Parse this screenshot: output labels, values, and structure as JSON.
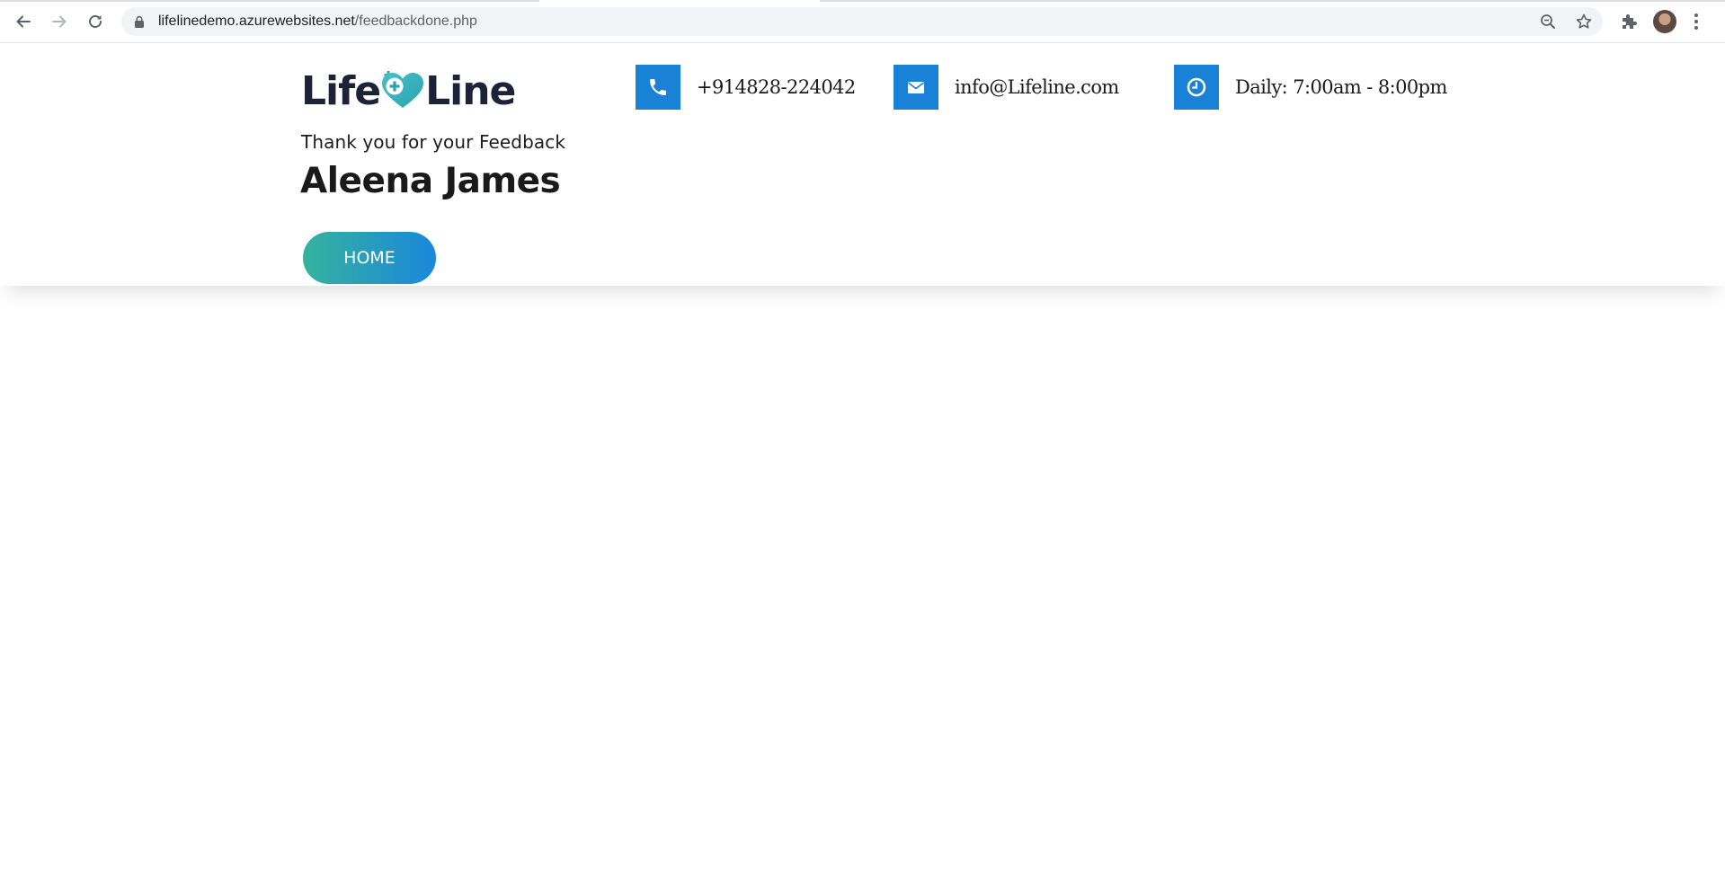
{
  "browser": {
    "url_host": "lifelinedemo.azurewebsites.net",
    "url_path": "/feedbackdone.php"
  },
  "brand": {
    "logo_part1": "Life",
    "logo_part2": "Line",
    "accent_teal": "#34b39e",
    "accent_blue": "#1a82d6",
    "text_dark": "#1c2237"
  },
  "contacts": {
    "phone": "+914828-224042",
    "email": "info@Lifeline.com",
    "hours": "Daily: 7:00am - 8:00pm"
  },
  "feedback": {
    "message": "Thank you for your Feedback",
    "name": "Aleena James"
  },
  "actions": {
    "home_label": "HOME"
  },
  "icons": {
    "back": "arrow-left-icon",
    "forward": "arrow-right-icon",
    "reload": "reload-icon",
    "lock": "lock-icon",
    "zoom": "zoom-icon",
    "bookmark": "star-icon",
    "extensions": "puzzle-icon",
    "profile": "avatar",
    "menu": "kebab-menu-icon",
    "phone": "phone-icon",
    "email": "envelope-icon",
    "hours": "clock-icon"
  }
}
